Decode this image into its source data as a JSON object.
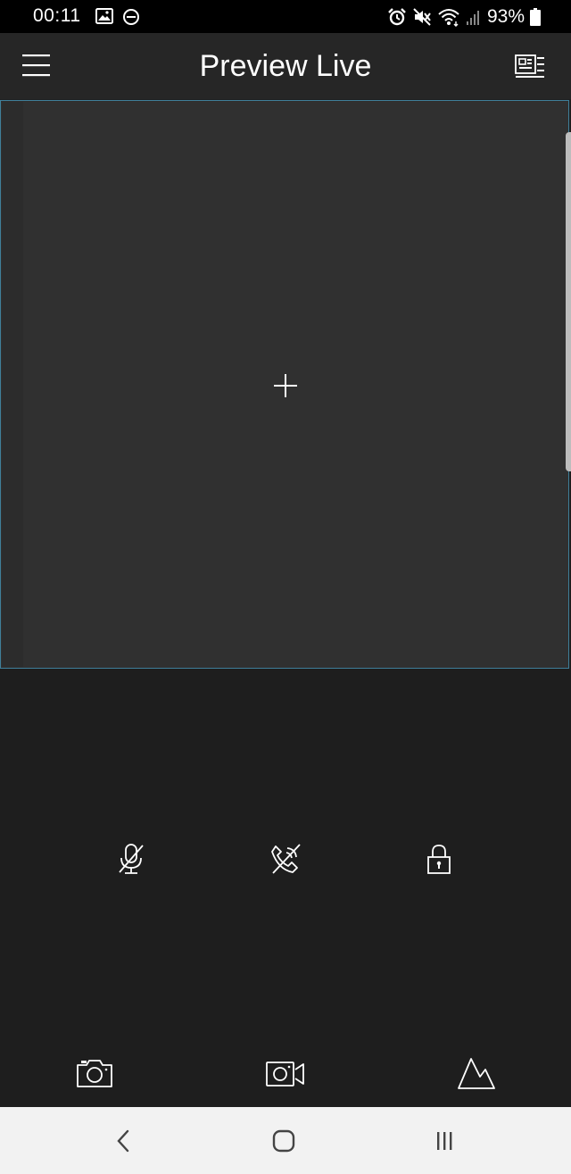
{
  "status_bar": {
    "time": "00:11",
    "battery_percent": "93%",
    "icons": [
      "image-icon",
      "dnd-icon",
      "alarm-icon",
      "mute-icon",
      "wifi-icon",
      "signal-icon",
      "battery-icon"
    ]
  },
  "header": {
    "title": "Preview Live",
    "menu_icon": "hamburger-menu-icon",
    "layout_icon": "device-list-icon"
  },
  "preview": {
    "add_icon": "plus-icon",
    "border_color": "#3f7f9a",
    "background": "#303030"
  },
  "controls": {
    "row1": [
      "microphone-off-icon",
      "phone-off-icon",
      "lock-icon"
    ],
    "row2": [
      "camera-snapshot-icon",
      "video-record-icon",
      "mountain-icon"
    ]
  },
  "nav_bar": {
    "buttons": [
      "back-icon",
      "home-icon",
      "recents-icon"
    ]
  },
  "colors": {
    "background": "#1e1e1e",
    "header": "#262626",
    "status_bar": "#000000",
    "nav_bar": "#f2f2f2"
  }
}
